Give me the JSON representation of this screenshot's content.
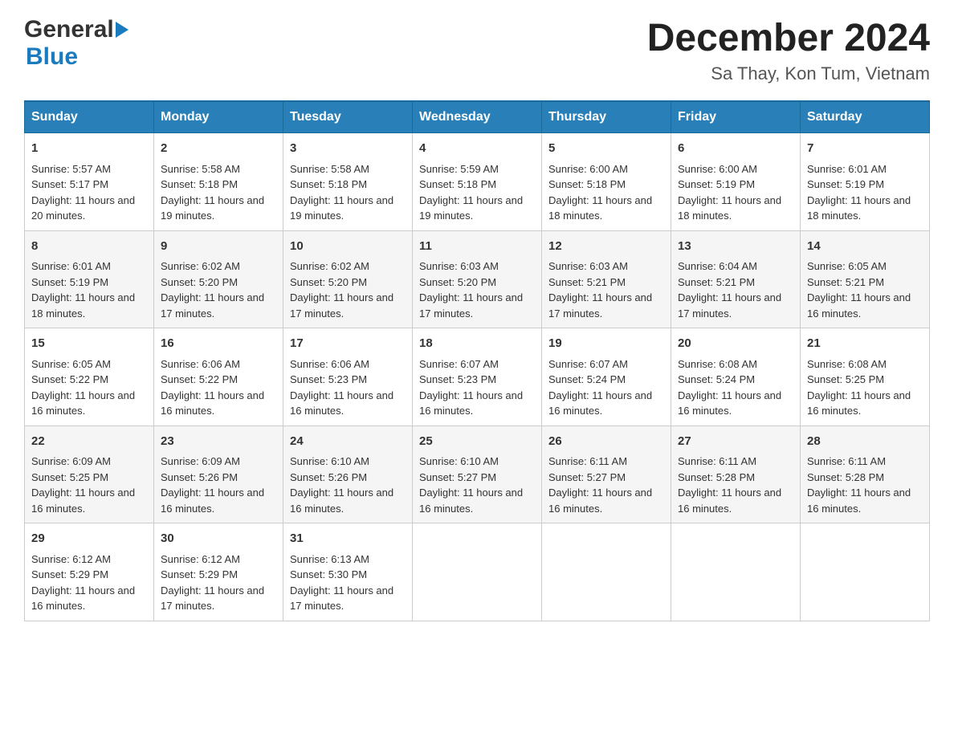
{
  "logo": {
    "text_general": "General",
    "text_blue": "Blue"
  },
  "title": "December 2024",
  "subtitle": "Sa Thay, Kon Tum, Vietnam",
  "weekdays": [
    "Sunday",
    "Monday",
    "Tuesday",
    "Wednesday",
    "Thursday",
    "Friday",
    "Saturday"
  ],
  "weeks": [
    [
      {
        "day": "1",
        "sunrise": "5:57 AM",
        "sunset": "5:17 PM",
        "daylight": "11 hours and 20 minutes."
      },
      {
        "day": "2",
        "sunrise": "5:58 AM",
        "sunset": "5:18 PM",
        "daylight": "11 hours and 19 minutes."
      },
      {
        "day": "3",
        "sunrise": "5:58 AM",
        "sunset": "5:18 PM",
        "daylight": "11 hours and 19 minutes."
      },
      {
        "day": "4",
        "sunrise": "5:59 AM",
        "sunset": "5:18 PM",
        "daylight": "11 hours and 19 minutes."
      },
      {
        "day": "5",
        "sunrise": "6:00 AM",
        "sunset": "5:18 PM",
        "daylight": "11 hours and 18 minutes."
      },
      {
        "day": "6",
        "sunrise": "6:00 AM",
        "sunset": "5:19 PM",
        "daylight": "11 hours and 18 minutes."
      },
      {
        "day": "7",
        "sunrise": "6:01 AM",
        "sunset": "5:19 PM",
        "daylight": "11 hours and 18 minutes."
      }
    ],
    [
      {
        "day": "8",
        "sunrise": "6:01 AM",
        "sunset": "5:19 PM",
        "daylight": "11 hours and 18 minutes."
      },
      {
        "day": "9",
        "sunrise": "6:02 AM",
        "sunset": "5:20 PM",
        "daylight": "11 hours and 17 minutes."
      },
      {
        "day": "10",
        "sunrise": "6:02 AM",
        "sunset": "5:20 PM",
        "daylight": "11 hours and 17 minutes."
      },
      {
        "day": "11",
        "sunrise": "6:03 AM",
        "sunset": "5:20 PM",
        "daylight": "11 hours and 17 minutes."
      },
      {
        "day": "12",
        "sunrise": "6:03 AM",
        "sunset": "5:21 PM",
        "daylight": "11 hours and 17 minutes."
      },
      {
        "day": "13",
        "sunrise": "6:04 AM",
        "sunset": "5:21 PM",
        "daylight": "11 hours and 17 minutes."
      },
      {
        "day": "14",
        "sunrise": "6:05 AM",
        "sunset": "5:21 PM",
        "daylight": "11 hours and 16 minutes."
      }
    ],
    [
      {
        "day": "15",
        "sunrise": "6:05 AM",
        "sunset": "5:22 PM",
        "daylight": "11 hours and 16 minutes."
      },
      {
        "day": "16",
        "sunrise": "6:06 AM",
        "sunset": "5:22 PM",
        "daylight": "11 hours and 16 minutes."
      },
      {
        "day": "17",
        "sunrise": "6:06 AM",
        "sunset": "5:23 PM",
        "daylight": "11 hours and 16 minutes."
      },
      {
        "day": "18",
        "sunrise": "6:07 AM",
        "sunset": "5:23 PM",
        "daylight": "11 hours and 16 minutes."
      },
      {
        "day": "19",
        "sunrise": "6:07 AM",
        "sunset": "5:24 PM",
        "daylight": "11 hours and 16 minutes."
      },
      {
        "day": "20",
        "sunrise": "6:08 AM",
        "sunset": "5:24 PM",
        "daylight": "11 hours and 16 minutes."
      },
      {
        "day": "21",
        "sunrise": "6:08 AM",
        "sunset": "5:25 PM",
        "daylight": "11 hours and 16 minutes."
      }
    ],
    [
      {
        "day": "22",
        "sunrise": "6:09 AM",
        "sunset": "5:25 PM",
        "daylight": "11 hours and 16 minutes."
      },
      {
        "day": "23",
        "sunrise": "6:09 AM",
        "sunset": "5:26 PM",
        "daylight": "11 hours and 16 minutes."
      },
      {
        "day": "24",
        "sunrise": "6:10 AM",
        "sunset": "5:26 PM",
        "daylight": "11 hours and 16 minutes."
      },
      {
        "day": "25",
        "sunrise": "6:10 AM",
        "sunset": "5:27 PM",
        "daylight": "11 hours and 16 minutes."
      },
      {
        "day": "26",
        "sunrise": "6:11 AM",
        "sunset": "5:27 PM",
        "daylight": "11 hours and 16 minutes."
      },
      {
        "day": "27",
        "sunrise": "6:11 AM",
        "sunset": "5:28 PM",
        "daylight": "11 hours and 16 minutes."
      },
      {
        "day": "28",
        "sunrise": "6:11 AM",
        "sunset": "5:28 PM",
        "daylight": "11 hours and 16 minutes."
      }
    ],
    [
      {
        "day": "29",
        "sunrise": "6:12 AM",
        "sunset": "5:29 PM",
        "daylight": "11 hours and 16 minutes."
      },
      {
        "day": "30",
        "sunrise": "6:12 AM",
        "sunset": "5:29 PM",
        "daylight": "11 hours and 17 minutes."
      },
      {
        "day": "31",
        "sunrise": "6:13 AM",
        "sunset": "5:30 PM",
        "daylight": "11 hours and 17 minutes."
      },
      null,
      null,
      null,
      null
    ]
  ],
  "labels": {
    "sunrise": "Sunrise:",
    "sunset": "Sunset:",
    "daylight": "Daylight:"
  }
}
